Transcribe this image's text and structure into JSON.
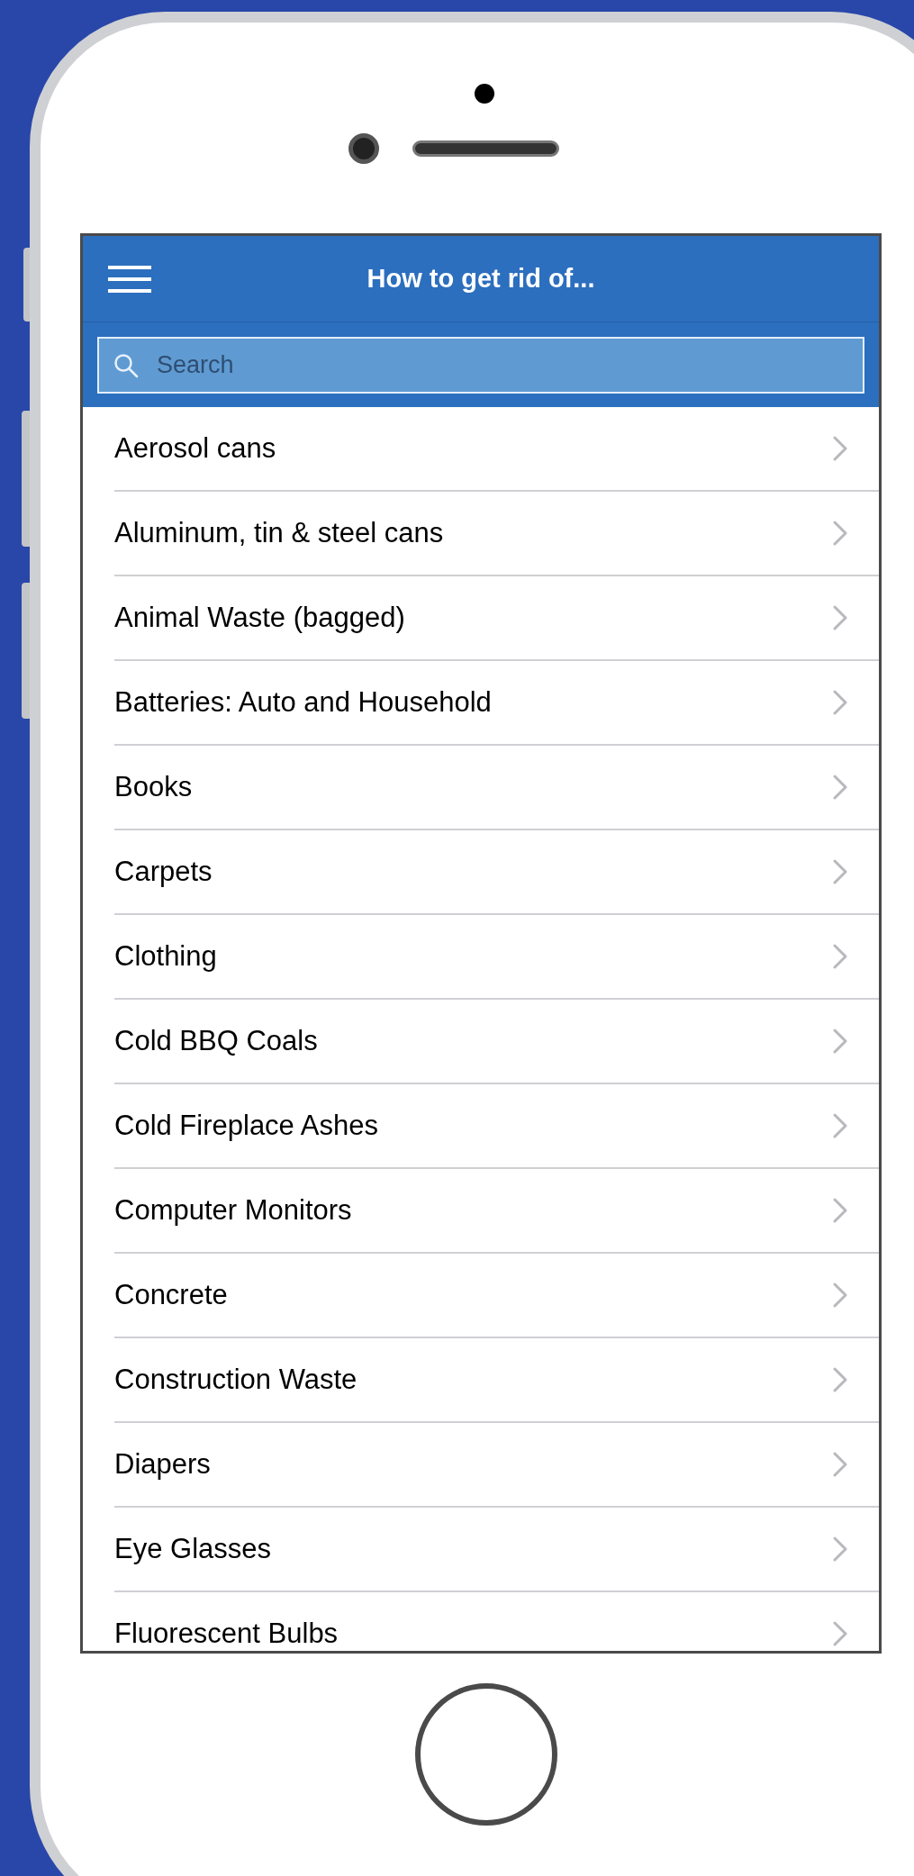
{
  "header": {
    "title": "How to get rid of..."
  },
  "search": {
    "placeholder": "Search"
  },
  "items": [
    {
      "label": "Aerosol cans"
    },
    {
      "label": "Aluminum, tin & steel cans"
    },
    {
      "label": "Animal Waste (bagged)"
    },
    {
      "label": "Batteries: Auto and Household"
    },
    {
      "label": "Books"
    },
    {
      "label": "Carpets"
    },
    {
      "label": "Clothing"
    },
    {
      "label": "Cold BBQ Coals"
    },
    {
      "label": "Cold Fireplace Ashes"
    },
    {
      "label": "Computer Monitors"
    },
    {
      "label": "Concrete"
    },
    {
      "label": "Construction Waste"
    },
    {
      "label": "Diapers"
    },
    {
      "label": "Eye Glasses"
    },
    {
      "label": "Fluorescent Bulbs"
    }
  ]
}
